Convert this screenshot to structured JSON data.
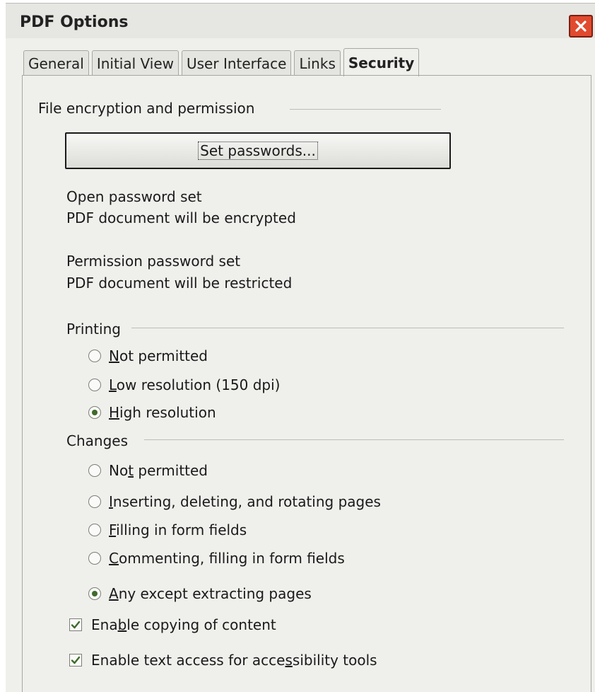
{
  "window": {
    "title": "PDF Options"
  },
  "tabs": [
    {
      "label": "General"
    },
    {
      "label": "Initial View"
    },
    {
      "label": "User Interface"
    },
    {
      "label": "Links"
    },
    {
      "label": "Security",
      "active": true
    }
  ],
  "encryption": {
    "section_label": "File encryption and permission",
    "set_passwords_label": "Set passwords...",
    "open_password_status": "Open password set",
    "open_password_note": "PDF document will be encrypted",
    "permission_password_status": "Permission password set",
    "permission_password_note": "PDF document will be restricted"
  },
  "printing": {
    "section_label": "Printing",
    "options": [
      {
        "mn": "N",
        "rest": "ot permitted",
        "selected": false
      },
      {
        "mn": "L",
        "rest": "ow resolution (150 dpi)",
        "selected": false
      },
      {
        "mn": "H",
        "rest": "igh resolution",
        "selected": true
      }
    ]
  },
  "changes": {
    "section_label": "Changes",
    "options": [
      {
        "pre": "No",
        "mn": "t",
        "rest": " permitted",
        "selected": false
      },
      {
        "pre": "",
        "mn": "I",
        "rest": "nserting, deleting, and rotating pages",
        "selected": false
      },
      {
        "pre": "",
        "mn": "F",
        "rest": "illing in form fields",
        "selected": false
      },
      {
        "pre": "",
        "mn": "C",
        "rest": "ommenting, filling in form fields",
        "selected": false
      },
      {
        "pre": "",
        "mn": "A",
        "rest": "ny except extracting pages",
        "selected": true
      }
    ]
  },
  "content": {
    "copy": {
      "pre": "Ena",
      "mn": "b",
      "rest": "le copying of content",
      "checked": true
    },
    "accessibility": {
      "pre": "Enable text access for acce",
      "mn": "s",
      "rest": "sibility tools",
      "checked": true
    }
  },
  "colors": {
    "accent_green": "#3e6b2a",
    "close_red": "#e14a2e"
  }
}
